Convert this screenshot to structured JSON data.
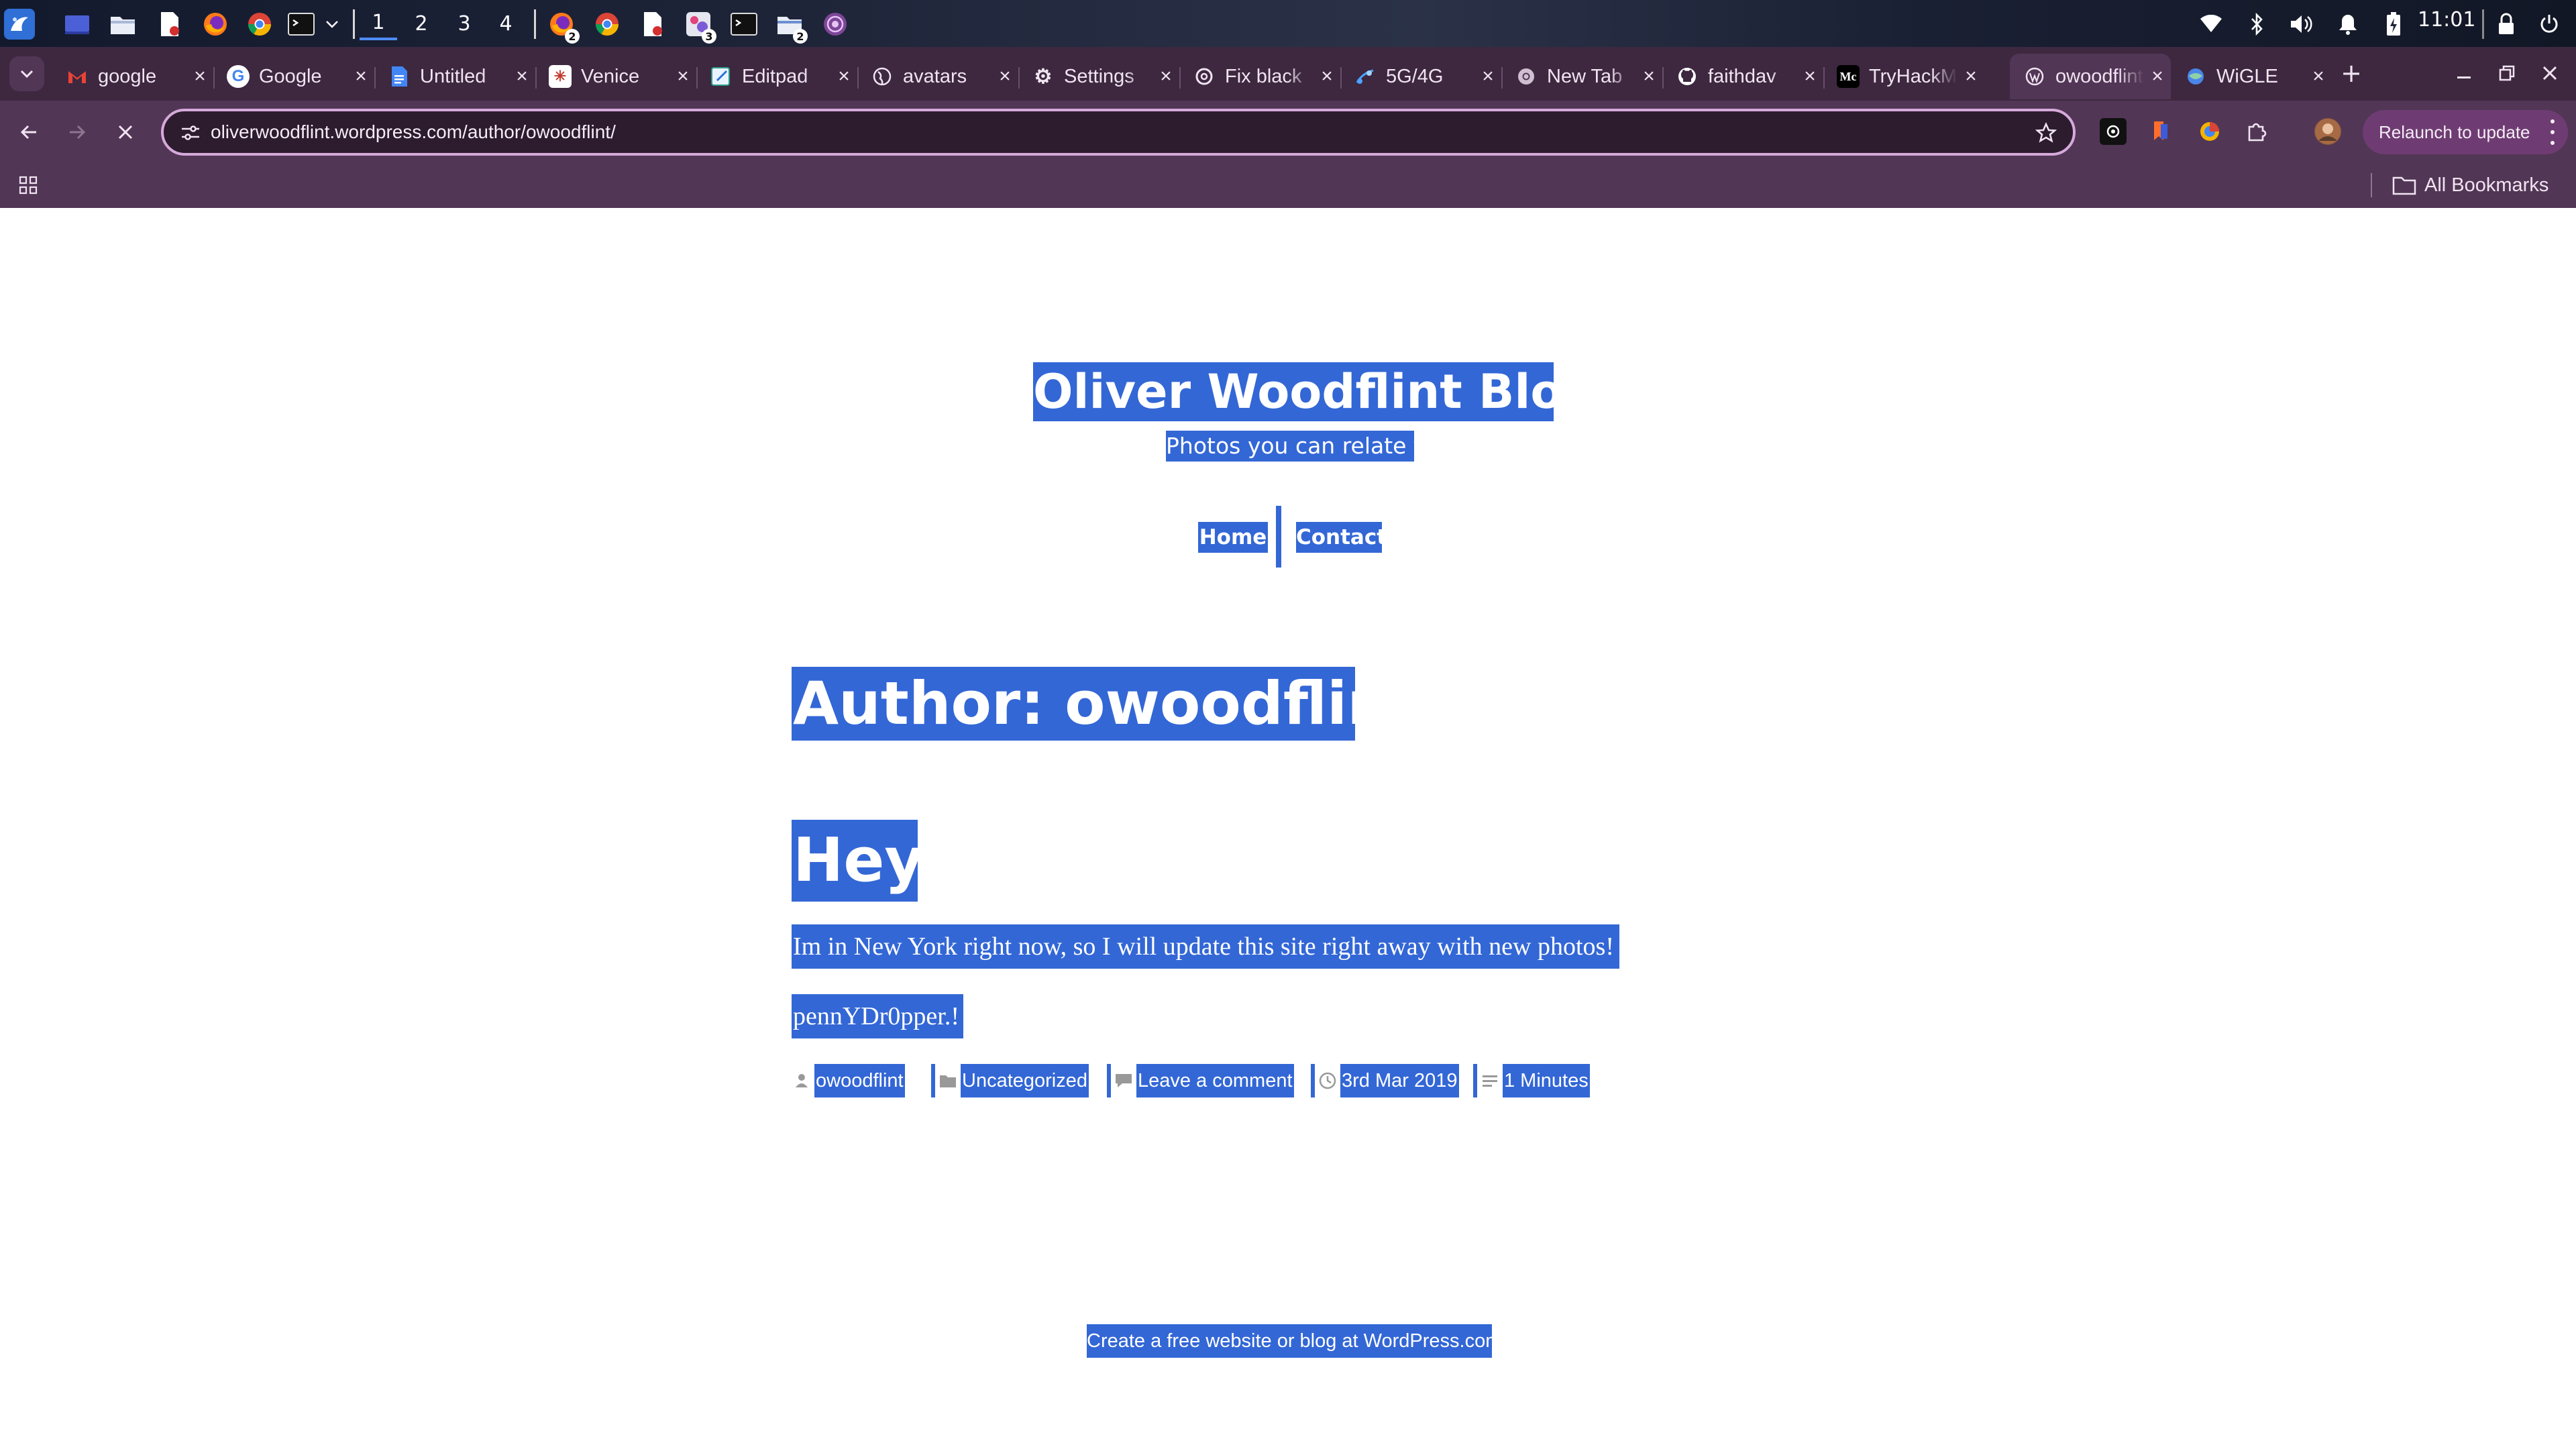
{
  "os_panel": {
    "workspaces": [
      "1",
      "2",
      "3",
      "4"
    ],
    "active_workspace": "1",
    "launcher_icons": [
      "app-launcher-icon",
      "desktop-icon",
      "file-manager-icon",
      "document-viewer-icon",
      "firefox-icon",
      "chrome-icon",
      "terminal-icon",
      "chevron-down-icon"
    ],
    "taskbar_apps": [
      {
        "icon": "firefox-icon",
        "badge": "2"
      },
      {
        "icon": "chrome-icon",
        "badge": ""
      },
      {
        "icon": "document-viewer-icon",
        "badge": ""
      },
      {
        "icon": "image-viewer-icon",
        "badge": "3"
      },
      {
        "icon": "terminal-icon",
        "badge": ""
      },
      {
        "icon": "file-manager-icon",
        "badge": "2"
      },
      {
        "icon": "tor-browser-icon",
        "badge": ""
      }
    ],
    "tray_icons": [
      "wifi-icon",
      "bluetooth-icon",
      "volume-icon",
      "notifications-icon",
      "battery-charging-icon"
    ],
    "clock": "11:01",
    "right_icons": [
      "lock-icon",
      "power-icon"
    ]
  },
  "browser": {
    "tab_search_icon": "chevron-down-icon",
    "tabs": [
      {
        "title": "google",
        "favicon": "gmail-icon",
        "active": false
      },
      {
        "title": "Google",
        "favicon": "google-icon",
        "active": false
      },
      {
        "title": "Untitled",
        "favicon": "google-docs-icon",
        "active": false
      },
      {
        "title": "Venice",
        "favicon": "venice-icon",
        "active": false
      },
      {
        "title": "Editpad",
        "favicon": "editpad-icon",
        "active": false
      },
      {
        "title": "avatars",
        "favicon": "globe-icon",
        "active": false
      },
      {
        "title": "Settings",
        "favicon": "settings-gear-icon",
        "active": false
      },
      {
        "title": "Fix black",
        "favicon": "openai-icon",
        "active": false
      },
      {
        "title": "5G/4G",
        "favicon": "signal-icon",
        "active": false
      },
      {
        "title": "New Tab",
        "favicon": "chrome-icon",
        "active": false
      },
      {
        "title": "faithdav",
        "favicon": "github-icon",
        "active": false
      },
      {
        "title": "TryHackMe",
        "favicon": "medium-icon",
        "active": false
      },
      {
        "title": "owoodflint",
        "favicon": "wordpress-icon",
        "active": true
      },
      {
        "title": "WiGLE",
        "favicon": "wigle-icon",
        "active": false
      }
    ],
    "new_tab_label": "+",
    "window_controls": [
      "minimize-icon",
      "restore-icon",
      "close-icon"
    ],
    "url": "oliverwoodflint.wordpress.com/author/owoodflint/",
    "relaunch_label": "Relaunch to update",
    "all_bookmarks_label": "All Bookmarks",
    "extension_icons": [
      "extension-ai-icon",
      "extension-bookmark-icon",
      "extension-color-icon",
      "extensions-puzzle-icon",
      "profile-avatar-icon"
    ]
  },
  "site": {
    "title": "Oliver Woodflint Blog",
    "tagline": "Photos you can relate to",
    "nav": [
      "Home",
      "Contact"
    ],
    "archive_title": "Author: owoodflint",
    "post": {
      "title": "Hey",
      "paragraphs": [
        "Im in New York right now, so I will update this site right away with new photos!",
        "pennYDr0pper.!"
      ],
      "meta": {
        "author": "owoodflint",
        "category": "Uncategorized",
        "comments": "Leave a comment",
        "date": "3rd Mar 2019",
        "reading_time": "1 Minutes"
      }
    },
    "footer_credit": "Create a free website or blog at WordPress.com."
  },
  "colors": {
    "selection": "#3367d6",
    "browser_frame": "#523656",
    "tab_strip": "#3d2840",
    "relaunch_button": "#6e3c72"
  }
}
